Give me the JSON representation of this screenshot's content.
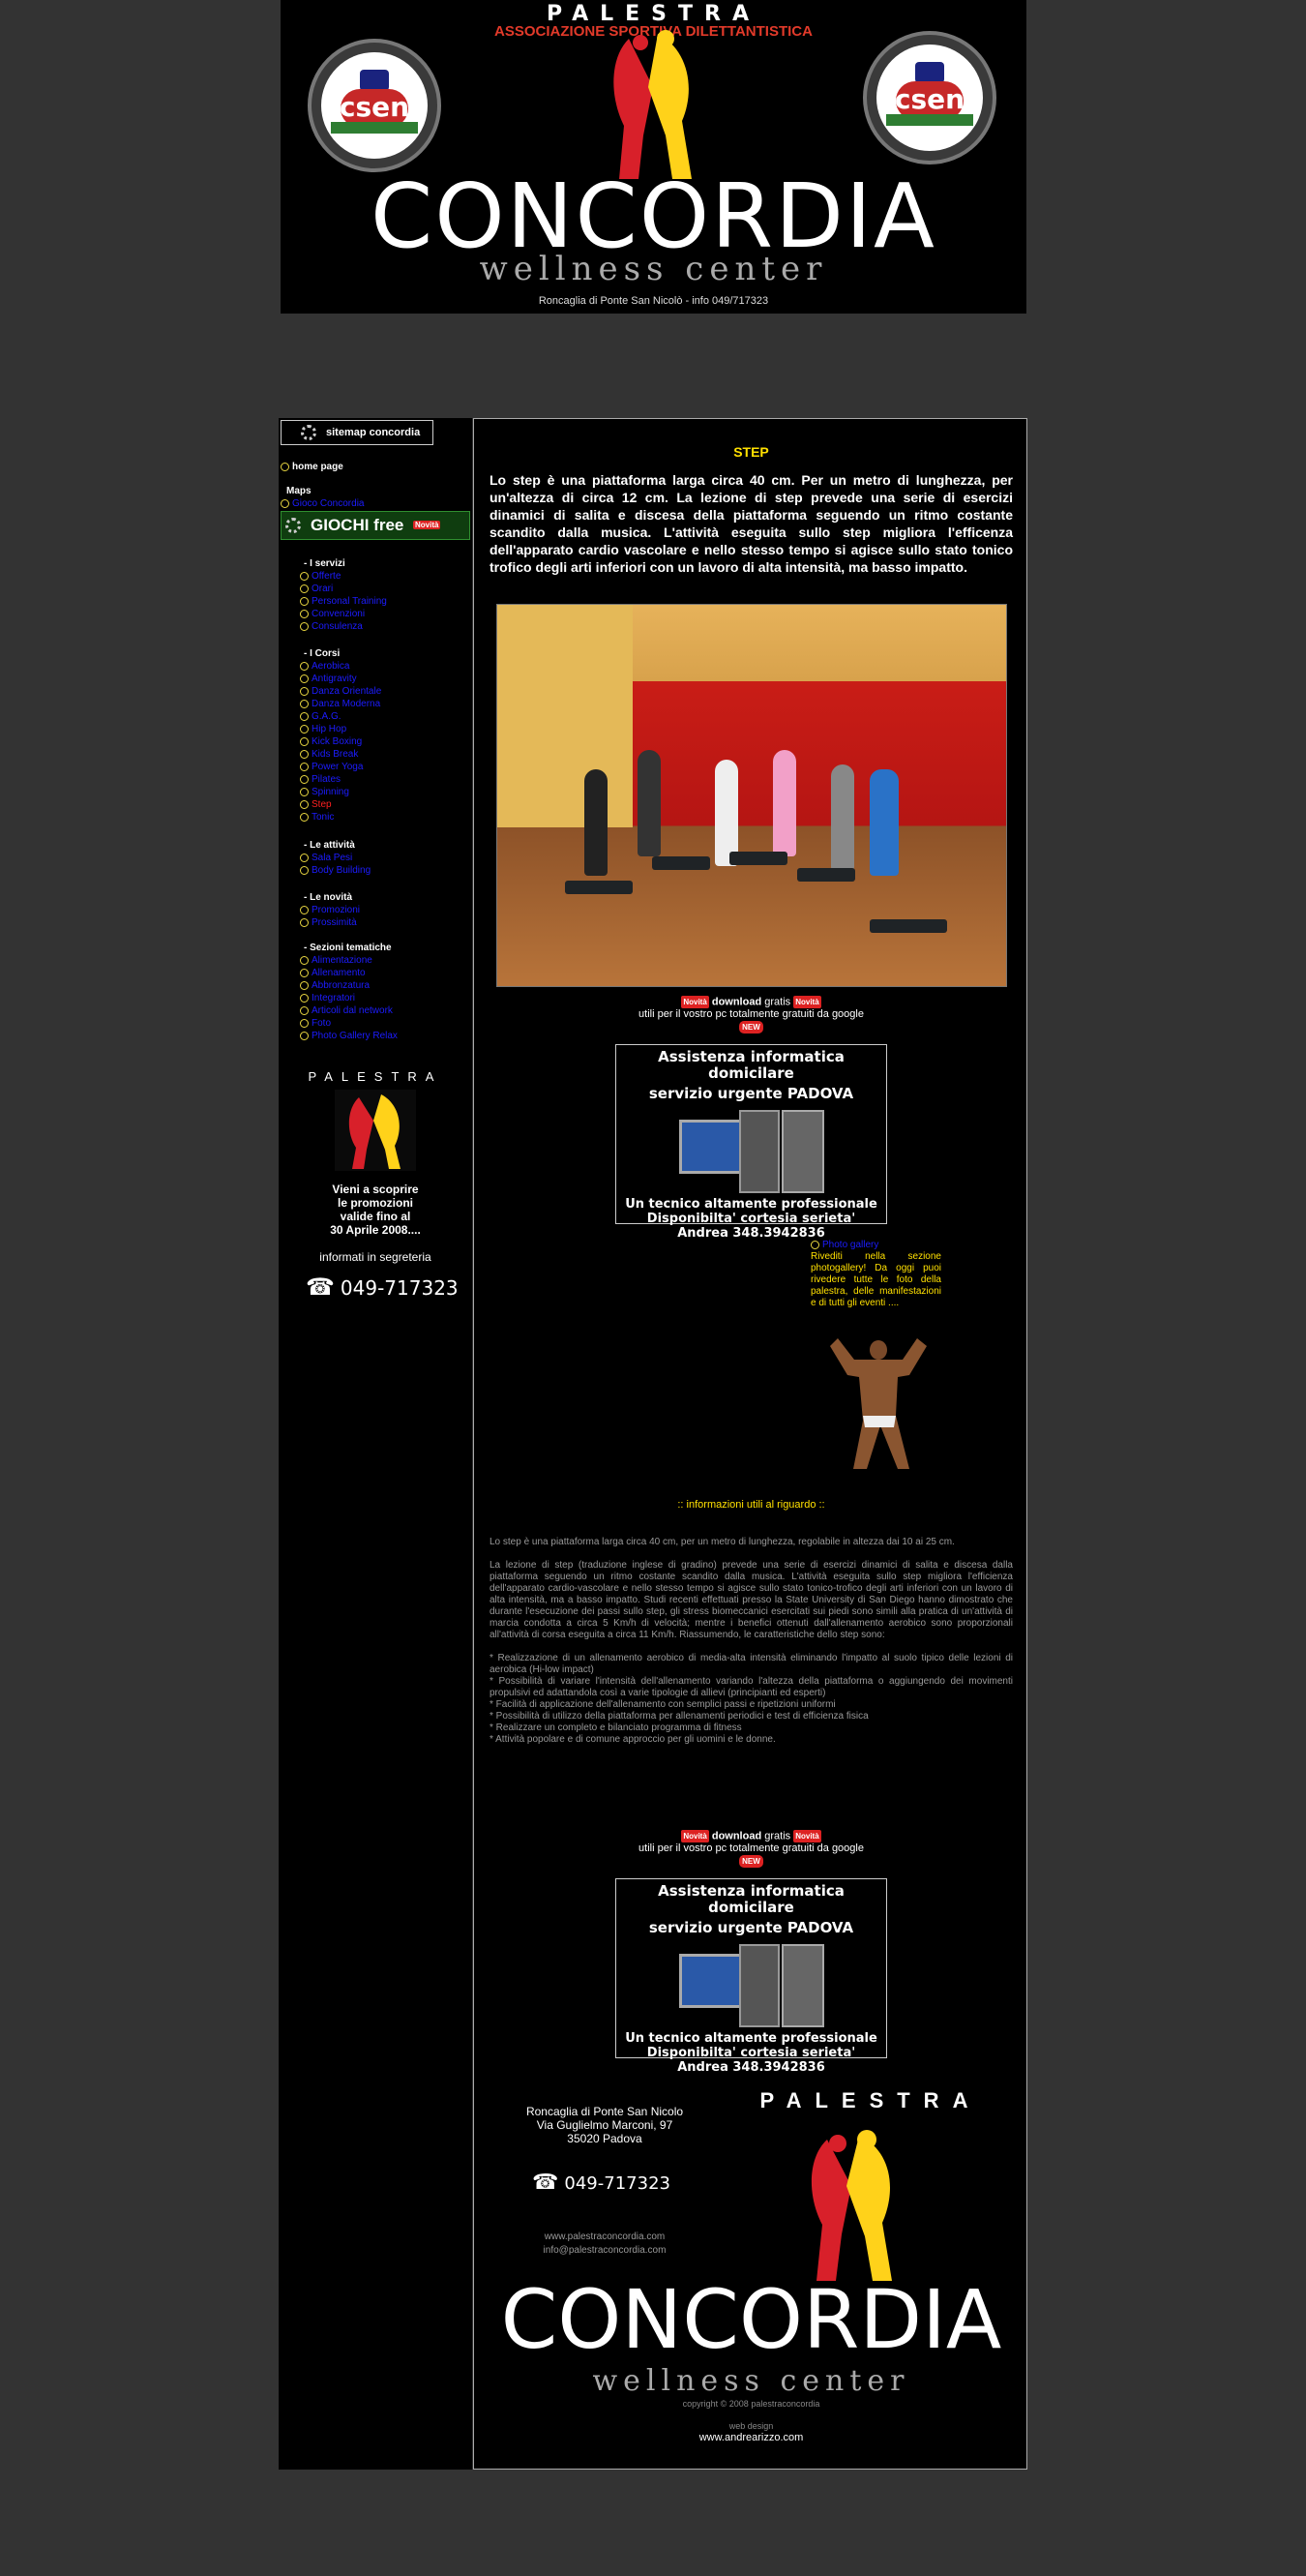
{
  "banner": {
    "palestra": "PALESTRA",
    "assoc": "ASSOCIAZIONE SPORTIVA DILETTANTISTICA",
    "badge_text": "csen",
    "concordia": "CONCORDIA",
    "wellness": "wellness center",
    "address": "Roncaglia di Ponte San Nicolò - info 049/717323"
  },
  "sidebar": {
    "sitemap": "sitemap concordia",
    "home": "home page",
    "maps_heading": "Maps",
    "maps_link": "Gioco Concordia",
    "giochi": "GIOCHI free",
    "novita_tag": "Novità",
    "servizi_heading": "- I servizi",
    "servizi": [
      "Offerte",
      "Orari",
      "Personal Training",
      "Convenzioni",
      "Consulenza"
    ],
    "corsi_heading": "- I Corsi",
    "corsi": [
      "Aerobica",
      "Antigravity",
      "Danza Orientale",
      "Danza Moderna",
      "G.A.G.",
      "Hip Hop",
      "Kick Boxing",
      "Kids Break",
      "Power Yoga",
      "Pilates",
      "Spinning",
      "Step",
      "Tonic"
    ],
    "attivita_heading": "- Le attività",
    "attivita": [
      "Sala Pesi",
      "Body Building"
    ],
    "novita_heading": "- Le novità",
    "novita": [
      "Promozioni",
      "Prossimità"
    ],
    "sezioni_heading": "- Sezioni tematiche",
    "sezioni": [
      "Alimentazione",
      "Allenamento",
      "Abbronzatura",
      "Integratori",
      "Articoli dal network",
      "Foto",
      "Photo Gallery Relax"
    ],
    "palestra": "PALESTRA",
    "promo": [
      "Vieni a scoprire",
      "le promozioni",
      "valide fino al",
      "30 Aprile 2008...."
    ],
    "segreteria": "informati in segreteria",
    "phone": "049-717323",
    "phone_icon": "telephone-icon"
  },
  "main": {
    "title": "STEP",
    "intro": "Lo step è una piattaforma larga circa 40 cm. Per un metro di lunghezza, per un'altezza di circa 12 cm. La lezione di step prevede una serie di esercizi dinamici di salita e discesa della piattaforma seguendo un ritmo costante scandito dalla musica. L'attività eseguita sullo step migliora l'efficenza dell'apparato cardio vascolare e nello stesso tempo si agisce sullo stato tonico trofico degli arti inferiori con un lavoro di alta intensità, ma  basso impatto.",
    "download": {
      "novita": "Novità",
      "download": "download",
      "gratis": "gratis",
      "line2": "utili per il vostro pc totalmente gratuiti da google",
      "new": "NEW"
    },
    "ad": {
      "line1": "Assistenza informatica domicilare",
      "line2": "servizio urgente PADOVA",
      "line3": "Un tecnico altamente professionale",
      "line4": "Disponibilta' cortesia serieta'",
      "line5": "Andrea 348.3942836"
    },
    "gallery_title": "Photo gallery",
    "gallery_text": "Rivediti nella sezione photogallery! Da oggi puoi rivedere tutte le foto della palestra, delle manifestazioni e di tutti gli eventi ....",
    "info_link": "::  informazioni  utili  al  riguardo  ::",
    "long_p1": "Lo step è una piattaforma larga circa 40 cm, per un metro di lunghezza, regolabile in altezza dai 10 ai 25 cm.",
    "long_p2": "La lezione di step (traduzione inglese di gradino) prevede una serie di esercizi dinamici di salita e discesa dalla piattaforma seguendo un ritmo costante scandito dalla musica. L'attività eseguita sullo step migliora l'efficienza dell'apparato cardio-vascolare e nello stesso tempo si agisce sullo stato tonico-trofico degli arti inferiori con un lavoro di alta intensità, ma a basso impatto. Studi recenti effettuati presso la State University di San Diego hanno dimostrato che durante l'esecuzione dei passi sullo step, gli stress biomeccanici esercitati sui piedi sono simili alla pratica di un'attività di marcia condotta a circa 5 Km/h di velocità; mentre i benefici ottenuti dall'allenamento aerobico sono proporzionali all'attività di corsa eseguita a circa 11 Km/h. Riassumendo, le caratteristiche dello step sono:",
    "long_list": [
      "* Realizzazione di un allenamento aerobico di media-alta intensità eliminando l'impatto al suolo tipico delle lezioni di aerobica (Hi-low impact)",
      "* Possibilità di variare l'intensità dell'allenamento variando l'altezza della piattaforma o aggiungendo dei movimenti propulsivi ed adattandola così a varie tipologie di allievi (principianti ed esperti)",
      "* Facilità di applicazione dell'allenamento con semplici passi e ripetizioni uniformi",
      "* Possibilità di utilizzo della piattaforma per allenamenti periodici e test di efficienza fisica",
      "* Realizzare un completo e bilanciato programma di fitness",
      "* Attività popolare e di comune approccio per gli uomini e le donne."
    ],
    "contact": [
      "Roncaglia di Ponte San Nicolo",
      "Via Guglielmo Marconi, 97",
      "35020 Padova"
    ],
    "phone": "049-717323",
    "web1": "www.palestraconcordia.com",
    "web2": "info@palestraconcordia.com",
    "foot_palestra": "PALESTRA",
    "foot_concordia": "CONCORDIA",
    "foot_wellness": "wellness center",
    "copyright": "copyright © 2008 palestraconcordia",
    "webdesign": "web design",
    "webdesign_url": "www.andrearizzo.com"
  }
}
